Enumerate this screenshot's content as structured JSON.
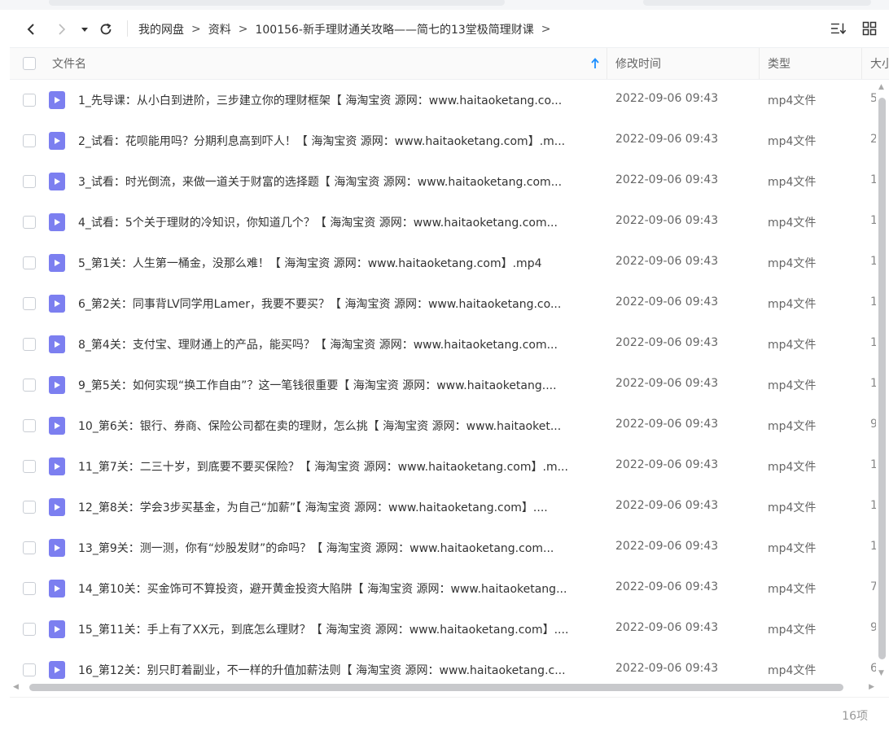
{
  "toolbar": {
    "back_icon": "chevron-left-icon",
    "forward_icon": "chevron-right-icon",
    "history_icon": "caret-down-icon",
    "refresh_icon": "refresh-icon",
    "sort_icon": "sort-list-icon",
    "view_icon": "grid-view-icon"
  },
  "breadcrumb": [
    "我的网盘",
    "资料",
    "100156-新手理财通关攻略——简七的13堂极简理财课"
  ],
  "columns": {
    "name": "文件名",
    "modified": "修改时间",
    "type": "类型",
    "size": "大小"
  },
  "colors": {
    "file_icon": "#7c7ff0",
    "sort_arrow": "#1e90ff"
  },
  "files": [
    {
      "name": "1_先导课：从小白到进阶，三步建立你的理财框架【 海淘宝资 源网：www.haitaoketang.co...",
      "modified": "2022-09-06 09:43",
      "type": "mp4文件",
      "size": "5"
    },
    {
      "name": "2_试看：花呗能用吗？分期利息高到吓人！【 海淘宝资 源网：www.haitaoketang.com】.m...",
      "modified": "2022-09-06 09:43",
      "type": "mp4文件",
      "size": "2"
    },
    {
      "name": "3_试看：时光倒流，来做一道关于财富的选择题【 海淘宝资 源网：www.haitaoketang.com...",
      "modified": "2022-09-06 09:43",
      "type": "mp4文件",
      "size": "1"
    },
    {
      "name": "4_试看：5个关于理财的冷知识，你知道几个？【 海淘宝资 源网：www.haitaoketang.com...",
      "modified": "2022-09-06 09:43",
      "type": "mp4文件",
      "size": "1"
    },
    {
      "name": "5_第1关：人生第一桶金，没那么难！【 海淘宝资 源网：www.haitaoketang.com】.mp4",
      "modified": "2022-09-06 09:43",
      "type": "mp4文件",
      "size": "1"
    },
    {
      "name": "6_第2关：同事背LV同学用Lamer，我要不要买？【 海淘宝资 源网：www.haitaoketang.co...",
      "modified": "2022-09-06 09:43",
      "type": "mp4文件",
      "size": "1"
    },
    {
      "name": "8_第4关：支付宝、理财通上的产品，能买吗？【 海淘宝资 源网：www.haitaoketang.com...",
      "modified": "2022-09-06 09:43",
      "type": "mp4文件",
      "size": "1"
    },
    {
      "name": "9_第5关：如何实现“换工作自由”？这一笔钱很重要【 海淘宝资 源网：www.haitaoketang....",
      "modified": "2022-09-06 09:43",
      "type": "mp4文件",
      "size": "1"
    },
    {
      "name": "10_第6关：银行、券商、保险公司都在卖的理财，怎么挑【 海淘宝资 源网：www.haitaoket...",
      "modified": "2022-09-06 09:43",
      "type": "mp4文件",
      "size": "9"
    },
    {
      "name": "11_第7关：二三十岁，到底要不要买保险？【 海淘宝资 源网：www.haitaoketang.com】.m...",
      "modified": "2022-09-06 09:43",
      "type": "mp4文件",
      "size": "1"
    },
    {
      "name": "12_第8关：学会3步买基金，为自己“加薪”【 海淘宝资 源网：www.haitaoketang.com】....",
      "modified": "2022-09-06 09:43",
      "type": "mp4文件",
      "size": "1"
    },
    {
      "name": "13_第9关：测一测，你有“炒股发财”的命吗？【 海淘宝资 源网：www.haitaoketang.com...",
      "modified": "2022-09-06 09:43",
      "type": "mp4文件",
      "size": "1"
    },
    {
      "name": "14_第10关：买金饰可不算投资，避开黄金投资大陷阱【 海淘宝资 源网：www.haitaoketang...",
      "modified": "2022-09-06 09:43",
      "type": "mp4文件",
      "size": "7"
    },
    {
      "name": "15_第11关：手上有了XX元，到底怎么理财？【 海淘宝资 源网：www.haitaoketang.com】....",
      "modified": "2022-09-06 09:43",
      "type": "mp4文件",
      "size": "9"
    },
    {
      "name": "16_第12关：别只盯着副业，不一样的升值加薪法则【 海淘宝资 源网：www.haitaoketang.c...",
      "modified": "2022-09-06 09:43",
      "type": "mp4文件",
      "size": "6"
    }
  ],
  "footer": {
    "count": "16项"
  }
}
